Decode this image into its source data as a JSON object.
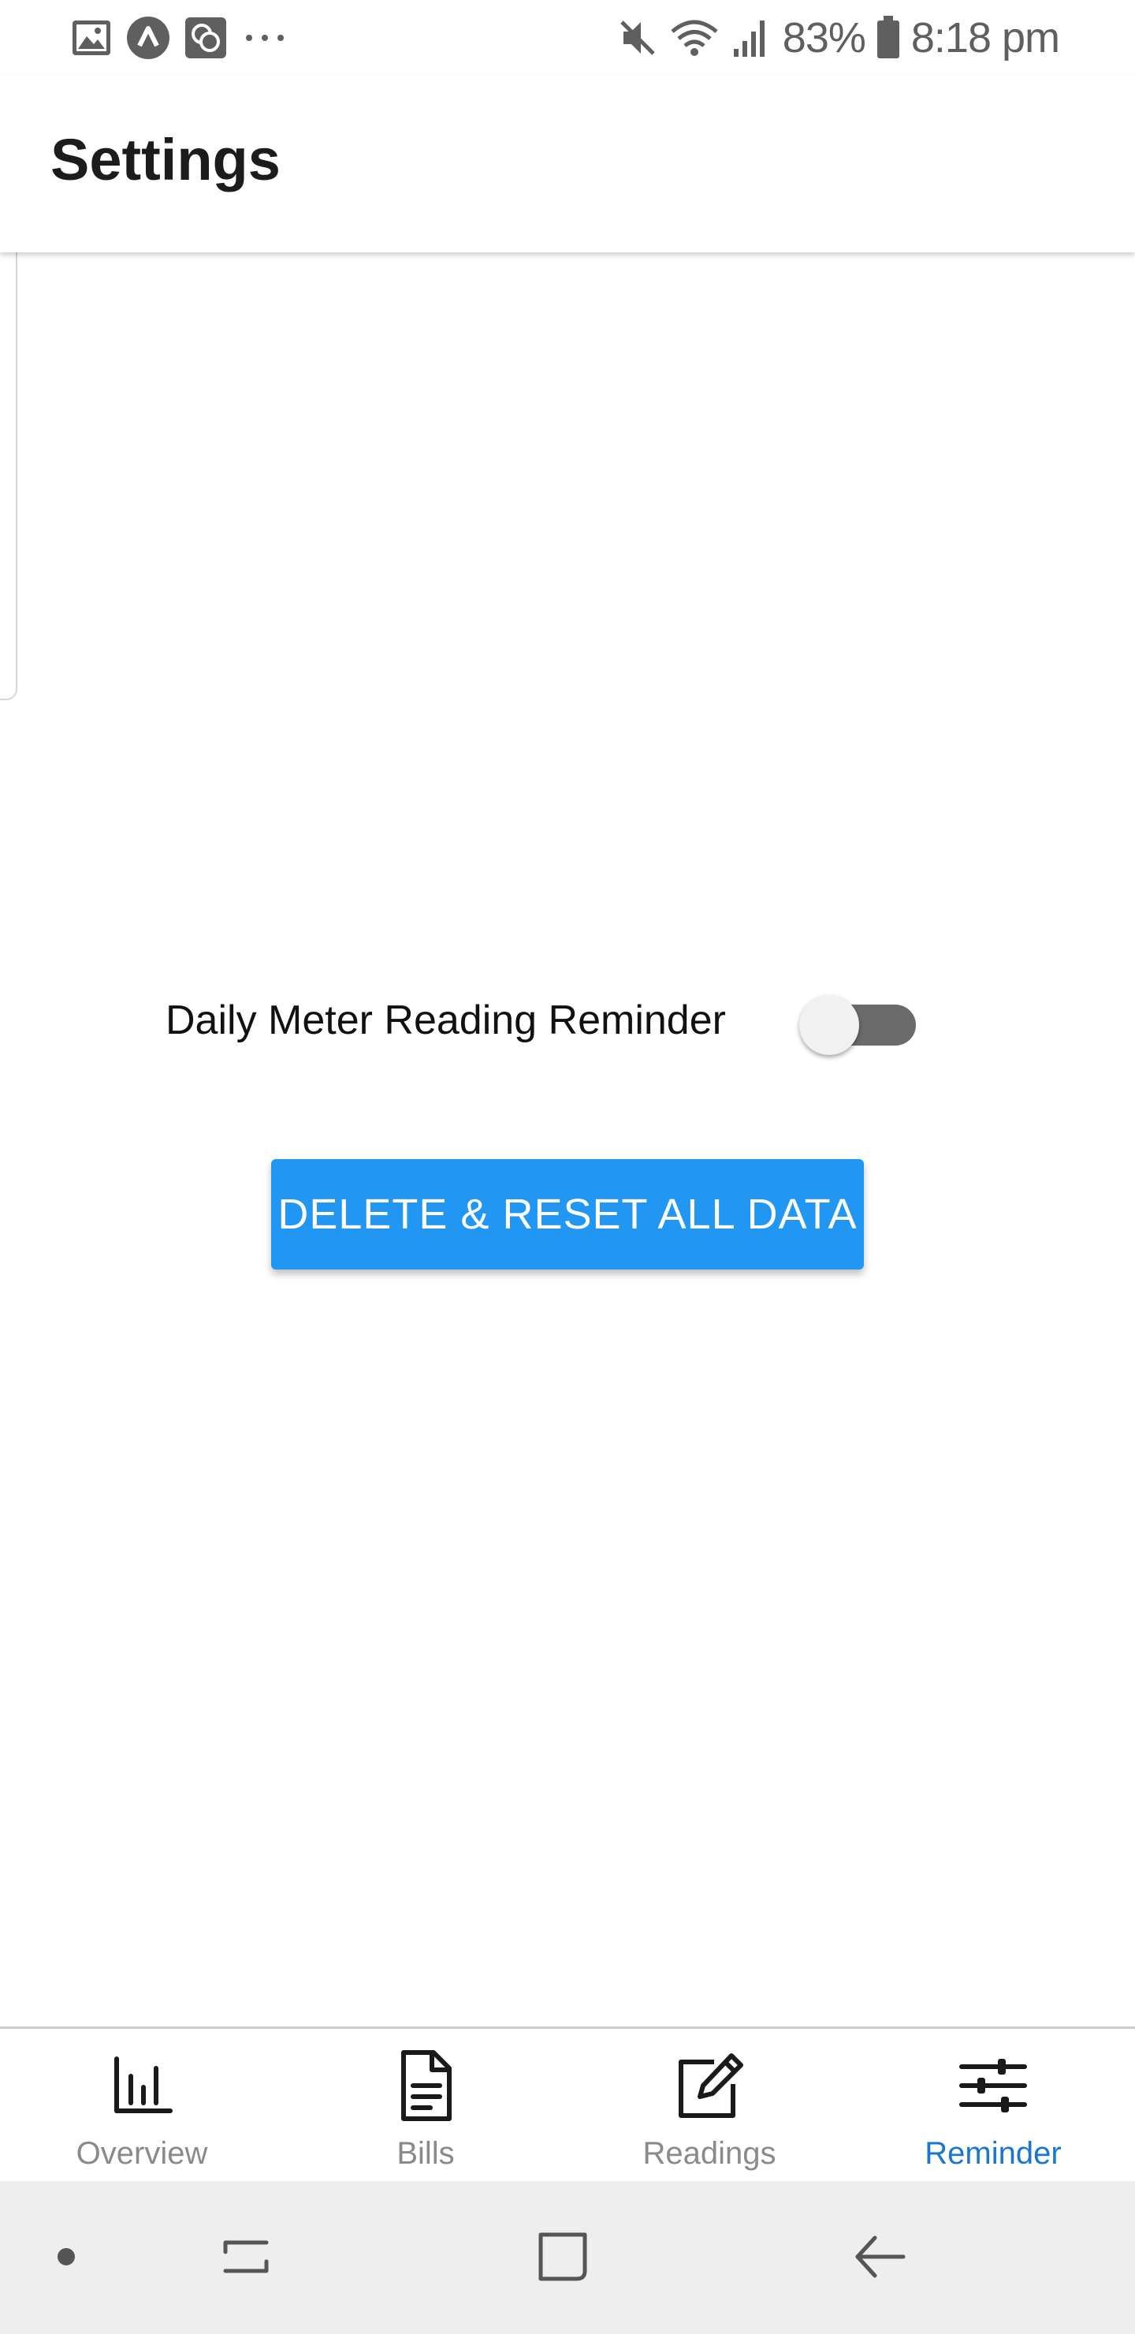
{
  "status_bar": {
    "battery": "83%",
    "time": "8:18 pm",
    "left_icons": [
      "gallery-icon",
      "app-icon",
      "chat-icon",
      "more-notifications-icon"
    ],
    "right_icons": [
      "mute-icon",
      "wifi-icon",
      "signal-icon",
      "battery-icon"
    ]
  },
  "header": {
    "title": "Settings"
  },
  "settings": {
    "reminder_label": "Daily Meter Reading Reminder",
    "reminder_enabled": false,
    "reset_button_label": "DELETE & RESET ALL DATA"
  },
  "tabs": [
    {
      "label": "Overview",
      "icon": "bar-chart-icon",
      "active": false
    },
    {
      "label": "Bills",
      "icon": "document-icon",
      "active": false
    },
    {
      "label": "Readings",
      "icon": "edit-icon",
      "active": false
    },
    {
      "label": "Reminder",
      "icon": "sliders-icon",
      "active": true
    }
  ],
  "colors": {
    "accent": "#2196f3",
    "active_tab": "#1976d2",
    "inactive_tab": "#8a8a8a",
    "toggle_track_off": "#6b6b6b"
  }
}
